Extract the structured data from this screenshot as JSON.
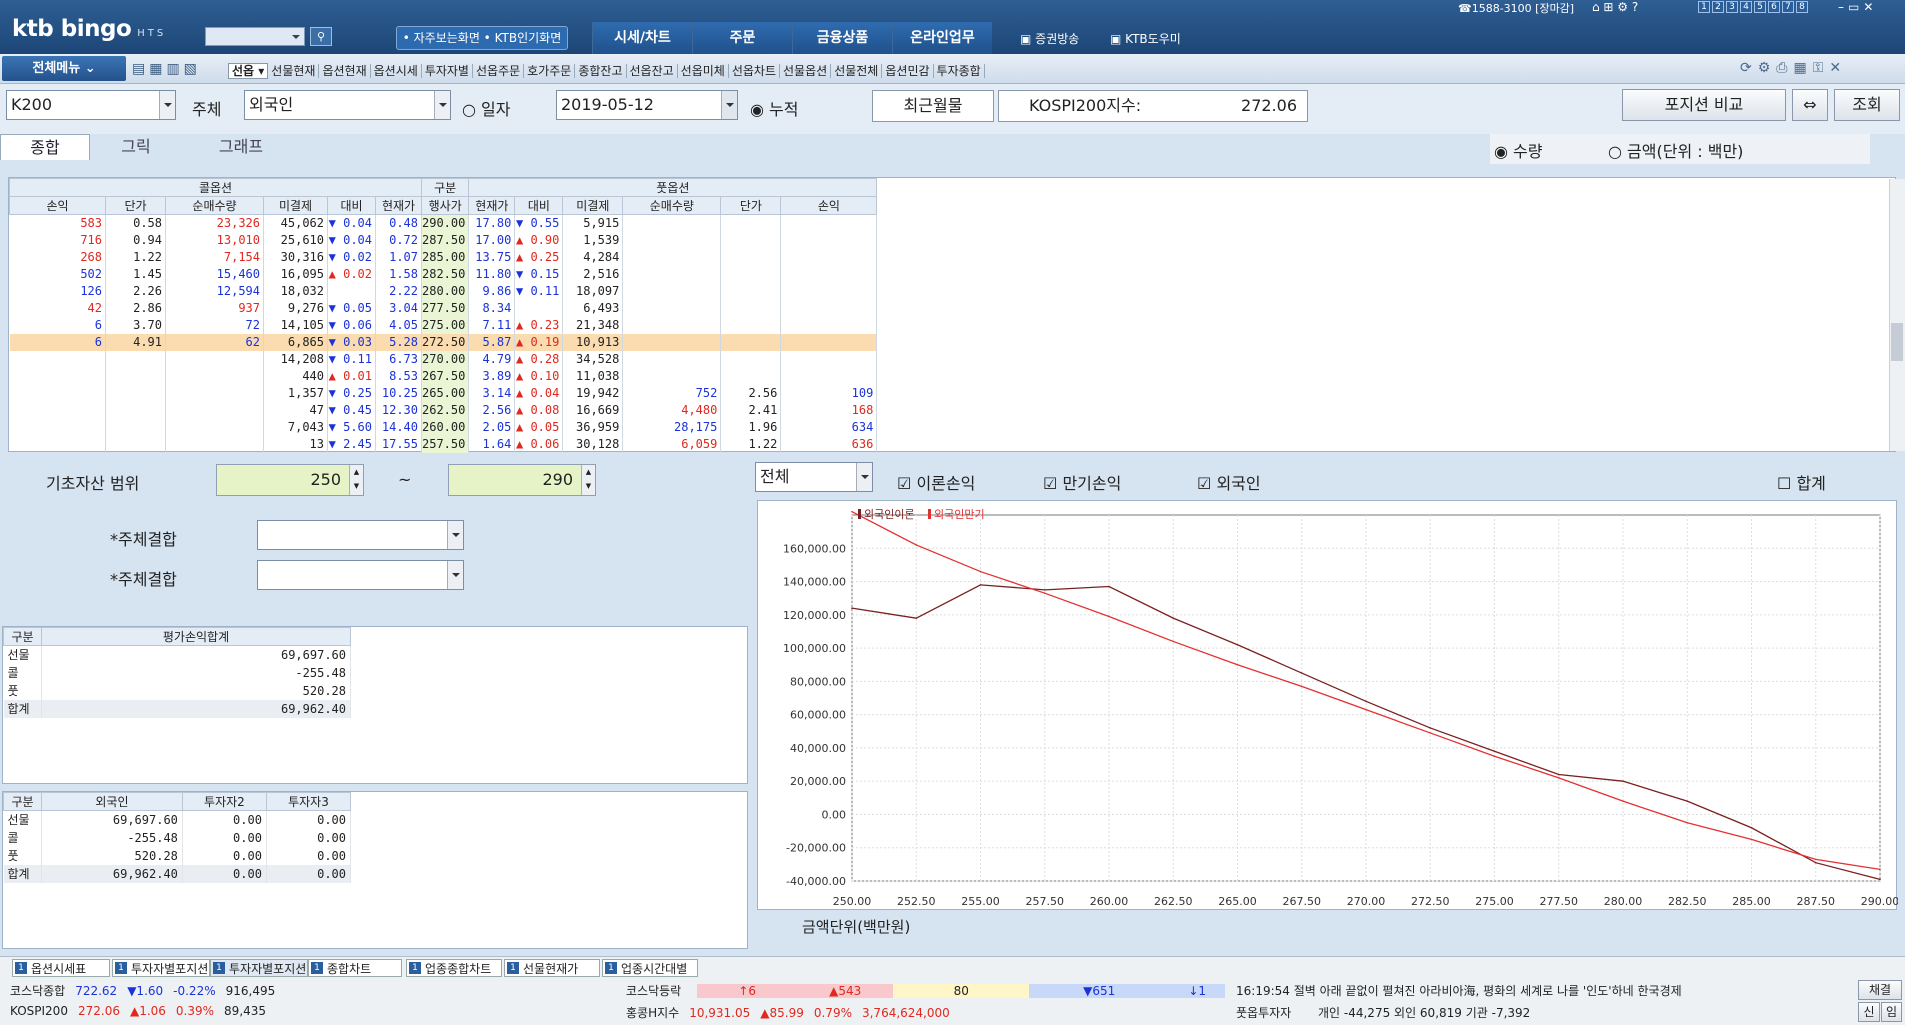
{
  "topbar": {
    "logo": "ktb bingo",
    "logo_sub": "HTS",
    "fav_label": "• 자주보는화면  • KTB인기화면",
    "nav": [
      "시세/차트",
      "주문",
      "금융상품",
      "온라인업무"
    ],
    "broadcast": "증권방송",
    "help": "KTB도우미",
    "phone": "☎1588-3100 [장마감]",
    "window_nums": [
      "1",
      "2",
      "3",
      "4",
      "5",
      "6",
      "7",
      "8"
    ]
  },
  "toolbar": {
    "allmenu": "전체메뉴 ⌄",
    "items": [
      "선옵 ▾",
      "선물현재",
      "옵션현재",
      "옵션시세",
      "투자자별",
      "선옵주문",
      "호가주문",
      "종합잔고",
      "선옵잔고",
      "선옵미체",
      "선옵차트",
      "선물옵션",
      "선물전체",
      "옵션민감",
      "투자종합"
    ]
  },
  "controls": {
    "code": "K200",
    "subject_label": "주체",
    "subject_value": "외국인",
    "daily_label": "일자",
    "date": "2019-05-12",
    "cumulative_label": "누적",
    "recent_month": "최근월물",
    "kospi_label": "KOSPI200지수:",
    "kospi_value": "272.06",
    "compare_btn": "포지션 비교",
    "search_btn": "조회"
  },
  "tabs": [
    "종합",
    "그릭",
    "그래프"
  ],
  "radios": {
    "qty": "수량",
    "amount": "금액(단위 : 백만)"
  },
  "grid": {
    "group_call": "콜옵션",
    "group_mid": "구분",
    "group_put": "풋옵션",
    "headers": [
      "손익",
      "단가",
      "순매수량",
      "미결제",
      "대비",
      "현재가",
      "행사가",
      "현재가",
      "대비",
      "미결제",
      "순매수량",
      "단가",
      "손익"
    ],
    "rows": [
      [
        "583",
        "0.58",
        "23,326",
        "45,062",
        "▼ 0.04",
        "0.48",
        "290.00",
        "17.80",
        "▼ 0.55",
        "5,915",
        "",
        "",
        ""
      ],
      [
        "716",
        "0.94",
        "13,010",
        "25,610",
        "▼ 0.04",
        "0.72",
        "287.50",
        "17.00",
        "▲ 0.90",
        "1,539",
        "",
        "",
        ""
      ],
      [
        "268",
        "1.22",
        "7,154",
        "30,316",
        "▼ 0.02",
        "1.07",
        "285.00",
        "13.75",
        "▲ 0.25",
        "4,284",
        "",
        "",
        ""
      ],
      [
        "502",
        "1.45",
        "15,460",
        "16,095",
        "▲ 0.02",
        "1.58",
        "282.50",
        "11.80",
        "▼ 0.15",
        "2,516",
        "",
        "",
        ""
      ],
      [
        "126",
        "2.26",
        "12,594",
        "18,032",
        "",
        "2.22",
        "280.00",
        "9.86",
        "▼ 0.11",
        "18,097",
        "",
        "",
        ""
      ],
      [
        "42",
        "2.86",
        "937",
        "9,276",
        "▼ 0.05",
        "3.04",
        "277.50",
        "8.34",
        "",
        "6,493",
        "",
        "",
        ""
      ],
      [
        "6",
        "3.70",
        "72",
        "14,105",
        "▼ 0.06",
        "4.05",
        "275.00",
        "7.11",
        "▲ 0.23",
        "21,348",
        "",
        "",
        ""
      ],
      [
        "6",
        "4.91",
        "62",
        "6,865",
        "▼ 0.03",
        "5.28",
        "272.50",
        "5.87",
        "▲ 0.19",
        "10,913",
        "",
        "",
        ""
      ],
      [
        "",
        "",
        "",
        "14,208",
        "▼ 0.11",
        "6.73",
        "270.00",
        "4.79",
        "▲ 0.28",
        "34,528",
        "",
        "",
        ""
      ],
      [
        "",
        "",
        "",
        "440",
        "▲ 0.01",
        "8.53",
        "267.50",
        "3.89",
        "▲ 0.10",
        "11,038",
        "",
        "",
        ""
      ],
      [
        "",
        "",
        "",
        "1,357",
        "▼ 0.25",
        "10.25",
        "265.00",
        "3.14",
        "▲ 0.04",
        "19,942",
        "752",
        "2.56",
        "109"
      ],
      [
        "",
        "",
        "",
        "47",
        "▼ 0.45",
        "12.30",
        "262.50",
        "2.56",
        "▲ 0.08",
        "16,669",
        "4,480",
        "2.41",
        "168"
      ],
      [
        "",
        "",
        "",
        "7,043",
        "▼ 5.60",
        "14.40",
        "260.00",
        "2.05",
        "▲ 0.05",
        "36,959",
        "28,175",
        "1.96",
        "634"
      ],
      [
        "",
        "",
        "",
        "13",
        "▼ 2.45",
        "17.55",
        "257.50",
        "1.64",
        "▲ 0.06",
        "30,128",
        "6,059",
        "1.22",
        "636"
      ]
    ],
    "highlight_row": 7
  },
  "range": {
    "label": "기초자산 범위",
    "from": "250",
    "tilde": "~",
    "to": "290"
  },
  "combine": {
    "label1": "*주체결합",
    "label2": "*주체결합"
  },
  "summary1": {
    "headers": [
      "구분",
      "평가손익합계"
    ],
    "rows": [
      [
        "선물",
        "69,697.60"
      ],
      [
        "콜",
        "-255.48"
      ],
      [
        "풋",
        "520.28"
      ],
      [
        "합계",
        "69,962.40"
      ]
    ]
  },
  "summary2": {
    "headers": [
      "구분",
      "외국인",
      "투자자2",
      "투자자3"
    ],
    "rows": [
      [
        "선물",
        "69,697.60",
        "0.00",
        "0.00"
      ],
      [
        "콜",
        "-255.48",
        "0.00",
        "0.00"
      ],
      [
        "풋",
        "520.28",
        "0.00",
        "0.00"
      ],
      [
        "합계",
        "69,962.40",
        "0.00",
        "0.00"
      ]
    ]
  },
  "chart_controls": {
    "scope": "전체",
    "theory": "이론손익",
    "expiry": "만기손익",
    "foreign": "외국인",
    "sum": "합계",
    "unit": "금액단위(백만원)"
  },
  "chart_data": {
    "type": "line",
    "legend": [
      "외국인이론",
      "외국인만기"
    ],
    "x": [
      250,
      252.5,
      255,
      257.5,
      260,
      262.5,
      265,
      267.5,
      270,
      272.5,
      275,
      277.5,
      280,
      282.5,
      285,
      287.5,
      290
    ],
    "xticks": [
      "250.00",
      "252.50",
      "255.00",
      "257.50",
      "260.00",
      "262.50",
      "265.00",
      "267.50",
      "270.00",
      "272.50",
      "275.00",
      "277.50",
      "280.00",
      "282.50",
      "285.00",
      "287.50",
      "290.00"
    ],
    "yticks": [
      "160,000.00",
      "140,000.00",
      "120,000.00",
      "100,000.00",
      "80,000.00",
      "60,000.00",
      "40,000.00",
      "20,000.00",
      "0.00",
      "-20,000.00",
      "-40,000.00"
    ],
    "ylim": [
      -40000,
      180000
    ],
    "series": [
      {
        "name": "외국인이론",
        "color": "#7a2020",
        "values": [
          124000,
          118000,
          138000,
          135000,
          137000,
          118000,
          102000,
          85000,
          68000,
          52000,
          38000,
          24000,
          20000,
          8000,
          -8000,
          -29000,
          -39000
        ]
      },
      {
        "name": "외국인만기",
        "color": "#e53030",
        "values": [
          182000,
          162000,
          146000,
          133000,
          119000,
          104000,
          90000,
          77000,
          63000,
          49000,
          35000,
          22000,
          8000,
          -5000,
          -15000,
          -27000,
          -33000
        ]
      }
    ]
  },
  "bottom_tabs": [
    "옵션시세표",
    "투자자별포지션",
    "투자자별포지션",
    "종합차트",
    "업종종합차트",
    "선물현재가",
    "업종시간대별"
  ],
  "status": {
    "r1": [
      {
        "t": "코스닥종합",
        "c": "k"
      },
      {
        "t": "722.62",
        "c": "b"
      },
      {
        "t": "▼1.60",
        "c": "b"
      },
      {
        "t": "-0.22%",
        "c": "b"
      },
      {
        "t": "916,495",
        "c": "k"
      }
    ],
    "r2": [
      {
        "t": "KOSPI200",
        "c": "k"
      },
      {
        "t": "272.06",
        "c": "r"
      },
      {
        "t": "▲1.06",
        "c": "r"
      },
      {
        "t": "0.39%",
        "c": "r"
      },
      {
        "t": "89,435",
        "c": "k"
      }
    ],
    "r3": [
      {
        "t": "코스닥등락",
        "c": "k"
      },
      {
        "t": "↑6",
        "c": "r"
      },
      {
        "t": "▲543",
        "c": "r"
      },
      {
        "t": "80",
        "c": "k"
      },
      {
        "t": "▼651",
        "c": "b"
      },
      {
        "t": "↓1",
        "c": "b"
      }
    ],
    "r4": [
      {
        "t": "홍콩H지수",
        "c": "k"
      },
      {
        "t": "10,931.05",
        "c": "r"
      },
      {
        "t": "▲85.99",
        "c": "r"
      },
      {
        "t": "0.79%",
        "c": "r"
      },
      {
        "t": "3,764,624,000",
        "c": "r"
      }
    ],
    "news": "16:19:54  절벽 아래 끝없이 펼쳐진 아라비아海, 평화의 세계로 나를 '인도'하네  한국경제",
    "put_investor": "풋옵투자자",
    "put_vals": "개인 -44,275  외인 60,819  기관 -7,392",
    "btn1": "채결",
    "btn2": "신",
    "btn3": "임"
  }
}
